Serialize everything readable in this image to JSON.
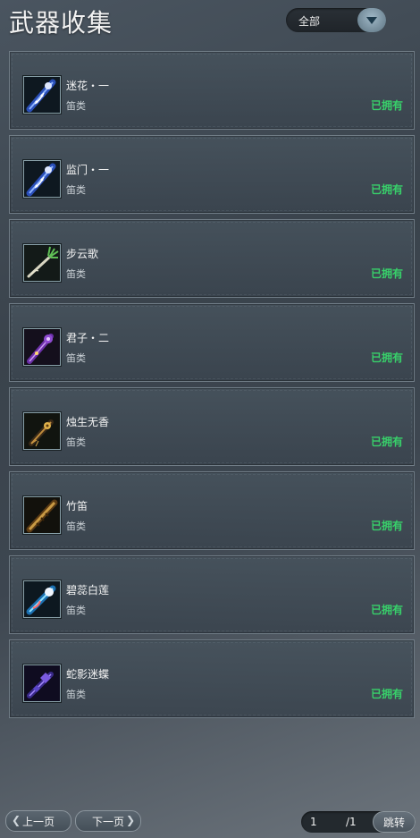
{
  "header": {
    "title": "武器收集",
    "filter_label": "全部"
  },
  "weapons": [
    {
      "name": "迷花・一",
      "type": "笛类",
      "status": "已拥有",
      "icon": "flute-blue-icon"
    },
    {
      "name": "监门・一",
      "type": "笛类",
      "status": "已拥有",
      "icon": "flute-blue-icon"
    },
    {
      "name": "步云歌",
      "type": "笛类",
      "status": "已拥有",
      "icon": "flute-jade-icon"
    },
    {
      "name": "君子・二",
      "type": "笛类",
      "status": "已拥有",
      "icon": "flute-purple-icon"
    },
    {
      "name": "烛生无香",
      "type": "笛类",
      "status": "已拥有",
      "icon": "flute-gold-icon"
    },
    {
      "name": "竹笛",
      "type": "笛类",
      "status": "已拥有",
      "icon": "bamboo-flute-icon"
    },
    {
      "name": "碧蕊白莲",
      "type": "笛类",
      "status": "已拥有",
      "icon": "flute-cyan-icon"
    },
    {
      "name": "蛇影迷蝶",
      "type": "笛类",
      "status": "已拥有",
      "icon": "flute-violet-icon"
    }
  ],
  "pager": {
    "prev_label": "上一页",
    "next_label": "下一页",
    "current_page": "1",
    "total_pages": "/1",
    "jump_label": "跳转"
  },
  "colors": {
    "owned": "#38d06a",
    "card_border": "#707c86"
  }
}
